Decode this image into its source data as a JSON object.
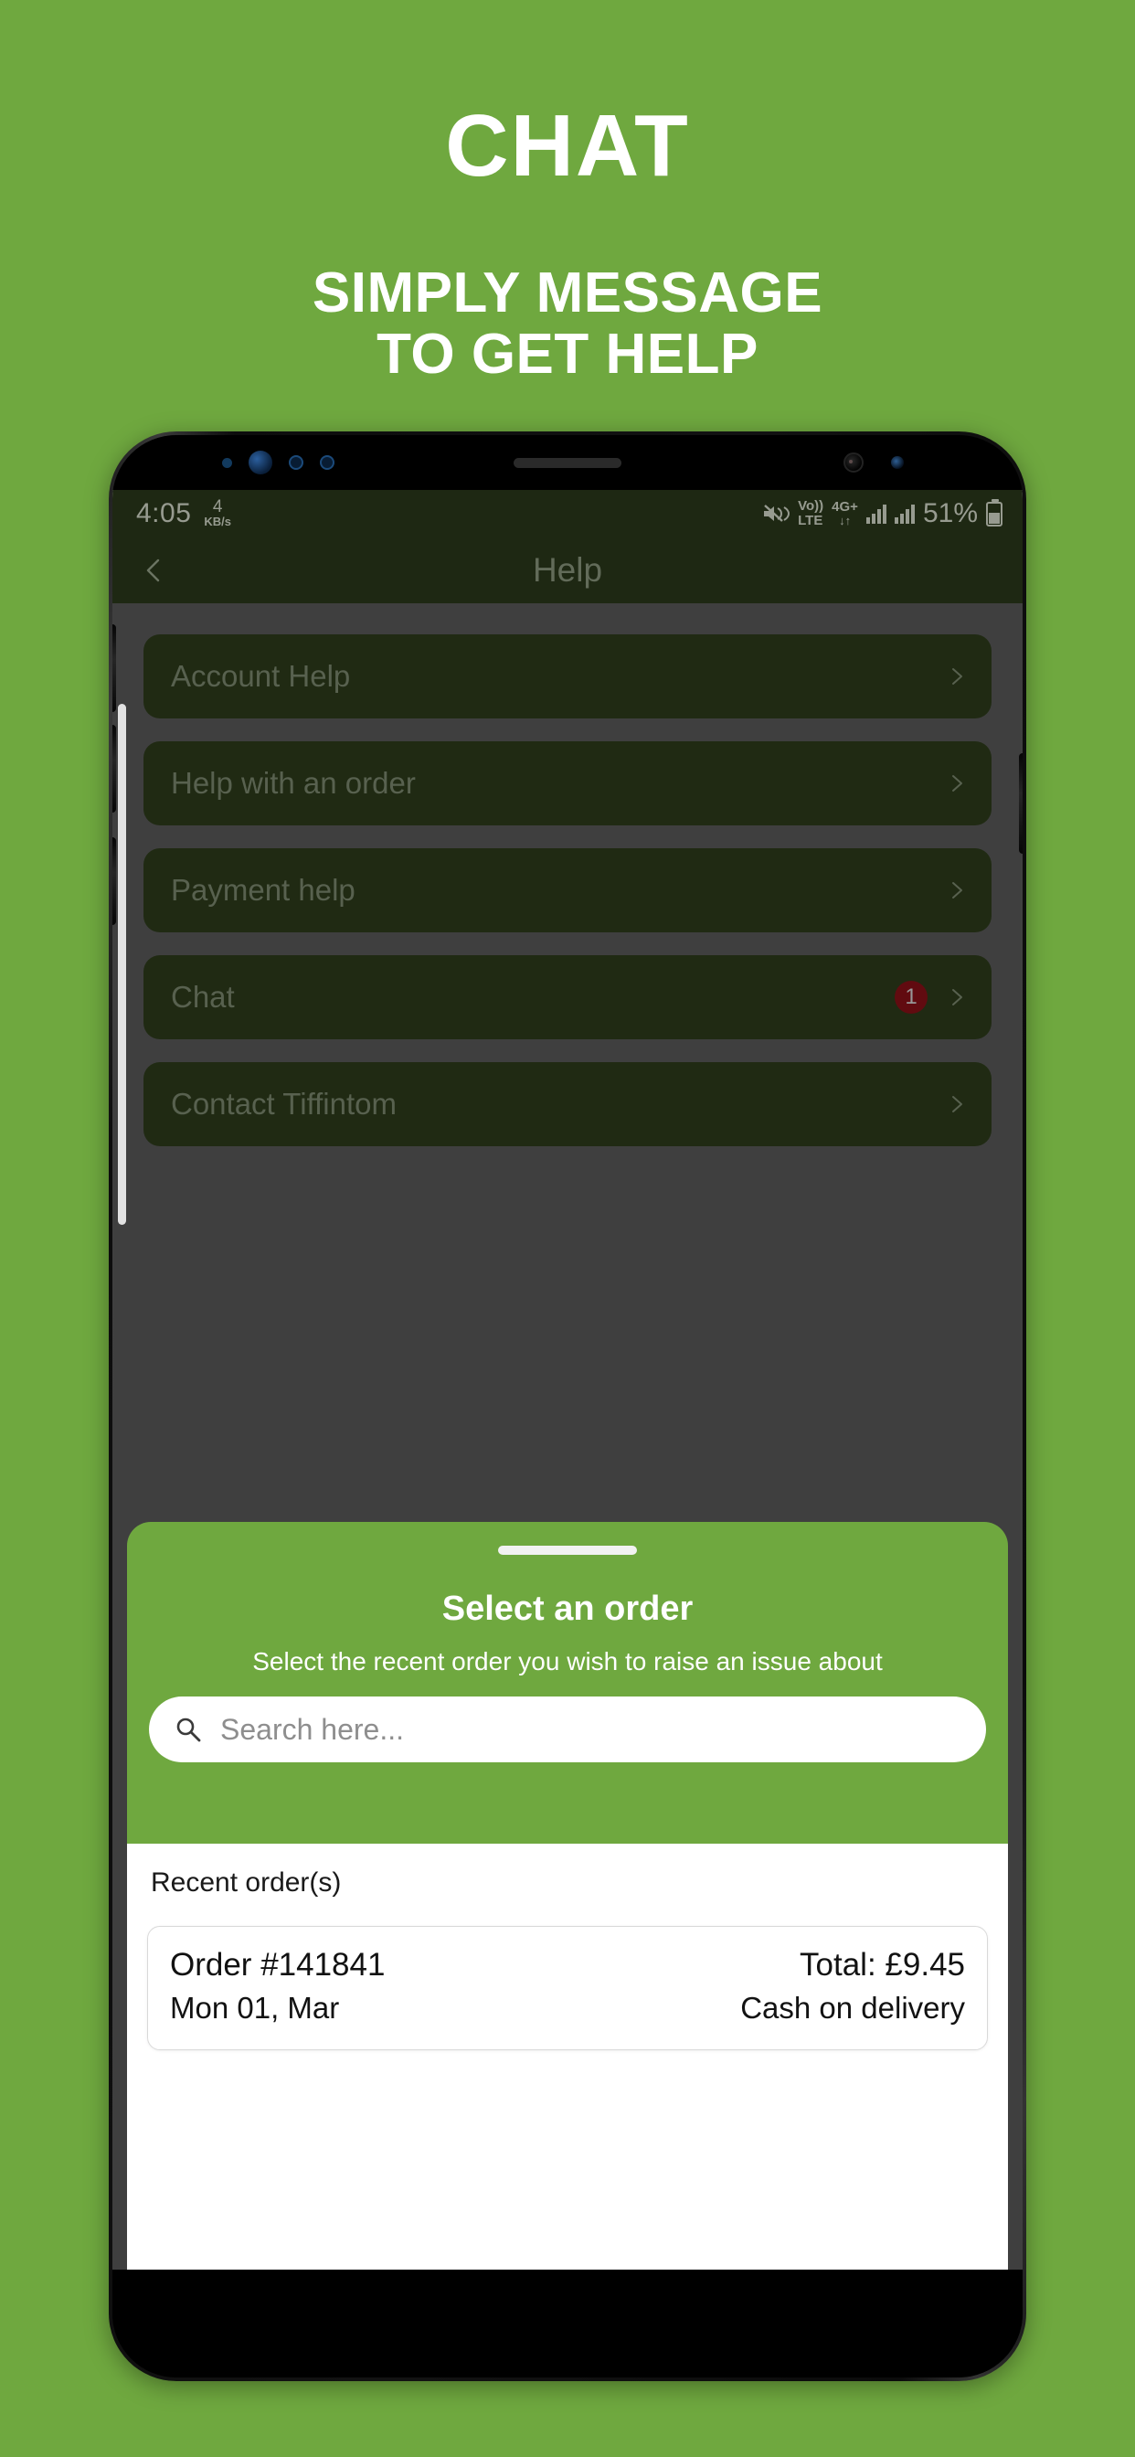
{
  "promo": {
    "title": "CHAT",
    "subtitle_line1": "SIMPLY MESSAGE",
    "subtitle_line2": "TO GET HELP"
  },
  "theme": {
    "brand_green": "#6fa83f",
    "appbar_green": "#2b3a1c",
    "row_green": "#2e3d1c",
    "badge_red": "#8b1018"
  },
  "statusbar": {
    "time": "4:05",
    "net_speed_value": "4",
    "net_speed_unit": "KB/s",
    "volte_line1": "Vo))",
    "volte_line2": "LTE",
    "network_type": "4G+",
    "battery_percent": "51%",
    "icons": [
      "mute-icon",
      "volte-icon",
      "4g-plus-icon",
      "signal-bars-icon",
      "signal-bars-icon",
      "battery-icon"
    ]
  },
  "appbar": {
    "title": "Help",
    "back_icon": "chevron-left-icon"
  },
  "help_list": {
    "items": [
      {
        "label": "Account Help",
        "badge": ""
      },
      {
        "label": "Help with an order",
        "badge": ""
      },
      {
        "label": "Payment help",
        "badge": ""
      },
      {
        "label": "Chat",
        "badge": "1"
      },
      {
        "label": "Contact Tiffintom",
        "badge": ""
      }
    ]
  },
  "sheet": {
    "title": "Select an order",
    "subtitle": "Select the recent order you wish to raise an issue about",
    "search_placeholder": "Search here...",
    "orders_heading": "Recent order(s)",
    "orders": [
      {
        "order_number": "Order #141841",
        "date": "Mon 01, Mar",
        "total": "Total: £9.45",
        "payment": "Cash on delivery"
      }
    ]
  }
}
